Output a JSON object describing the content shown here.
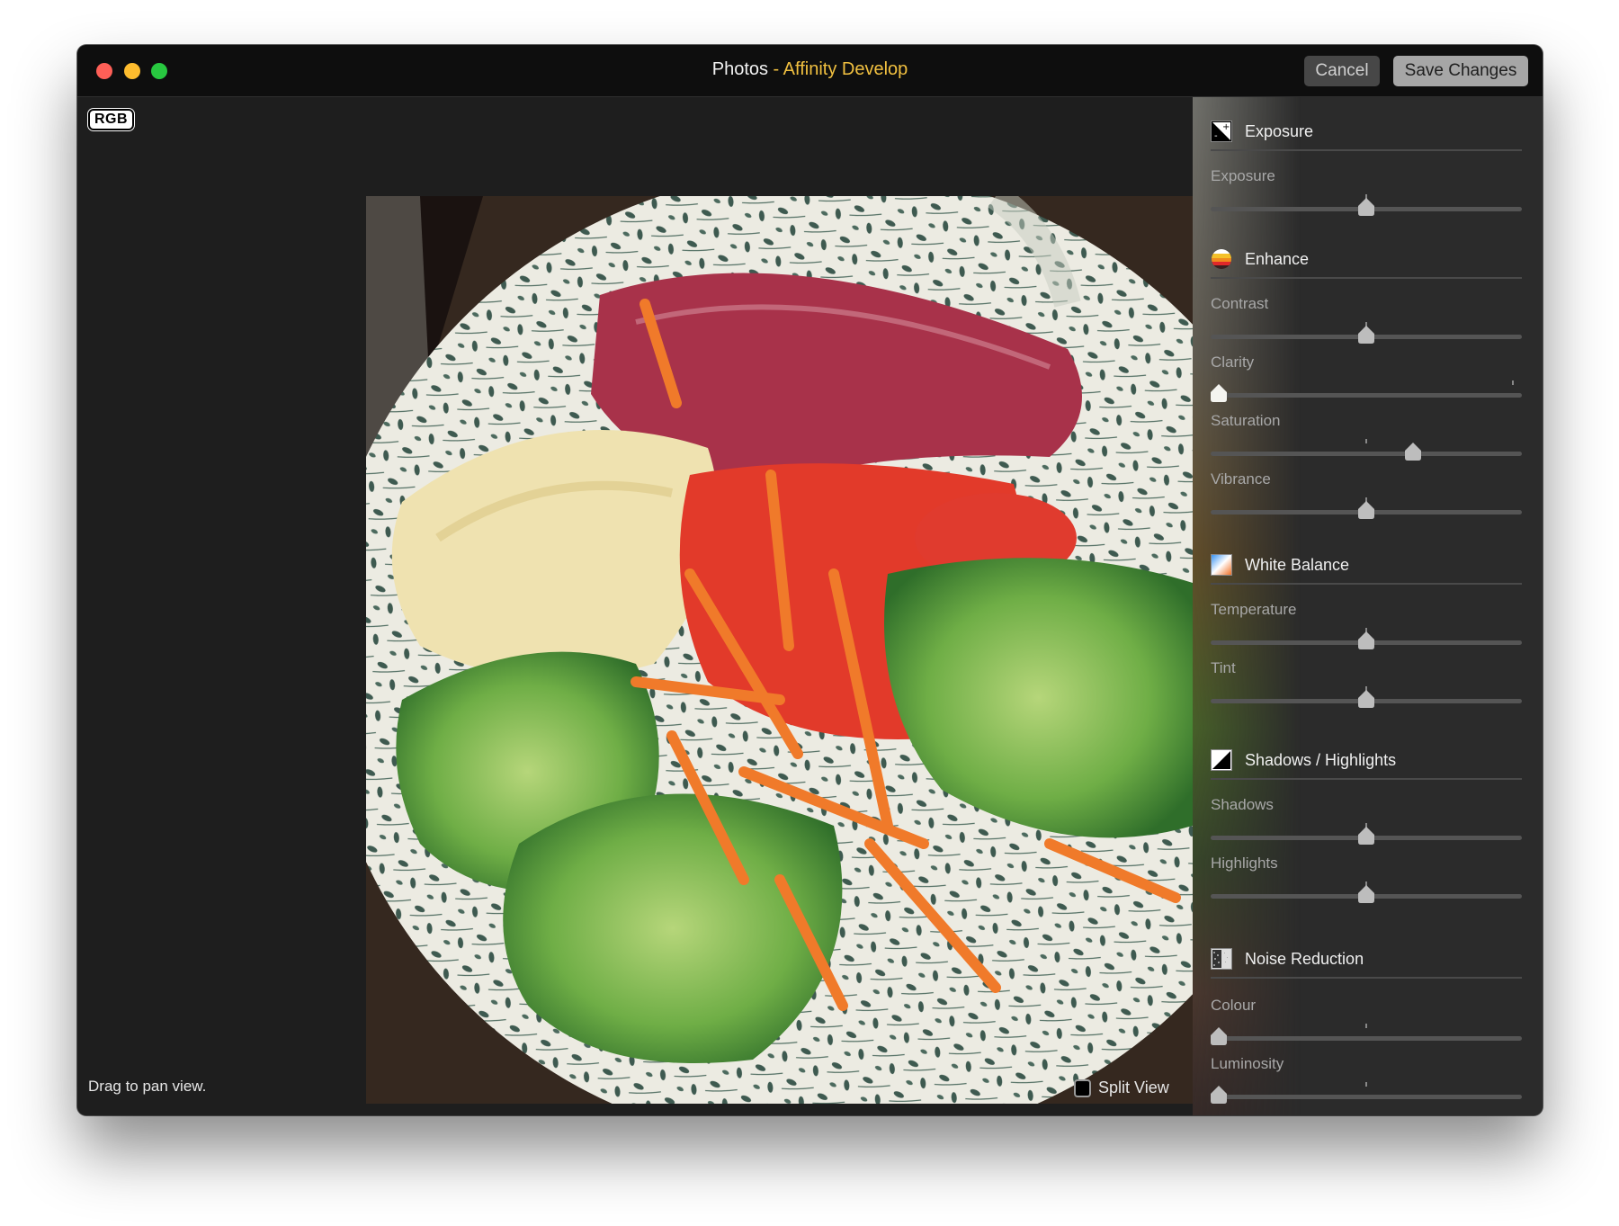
{
  "window": {
    "title_prefix": "Photos",
    "title_separator": " - ",
    "title_app": "Affinity Develop",
    "cancel_label": "Cancel",
    "save_label": "Save Changes"
  },
  "canvas": {
    "color_mode_badge": "RGB",
    "hint": "Drag to pan view.",
    "split_view_label": "Split View",
    "split_view_checked": false
  },
  "sidebar": {
    "sections": [
      {
        "id": "exposure",
        "title": "Exposure",
        "icon": "exposure-icon",
        "sliders": [
          {
            "label": "Exposure",
            "value": 0.5,
            "default": 0.5
          }
        ]
      },
      {
        "id": "enhance",
        "title": "Enhance",
        "icon": "enhance-icon",
        "sliders": [
          {
            "label": "Contrast",
            "value": 0.5,
            "default": 0.5
          },
          {
            "label": "Clarity",
            "value": 0.0,
            "default": 0.97,
            "active": true
          },
          {
            "label": "Saturation",
            "value": 0.66,
            "default": 0.5
          },
          {
            "label": "Vibrance",
            "value": 0.5,
            "default": 0.5
          }
        ]
      },
      {
        "id": "white-balance",
        "title": "White Balance",
        "icon": "white-balance-icon",
        "sliders": [
          {
            "label": "Temperature",
            "value": 0.5,
            "default": 0.5
          },
          {
            "label": "Tint",
            "value": 0.5,
            "default": 0.5
          }
        ]
      },
      {
        "id": "shadows-highlights",
        "title": "Shadows / Highlights",
        "icon": "shadows-highlights-icon",
        "sliders": [
          {
            "label": "Shadows",
            "value": 0.5,
            "default": 0.5
          },
          {
            "label": "Highlights",
            "value": 0.5,
            "default": 0.5
          }
        ]
      },
      {
        "id": "noise-reduction",
        "title": "Noise Reduction",
        "icon": "noise-reduction-icon",
        "sliders": [
          {
            "label": "Colour",
            "value": 0.0,
            "default": 0.5
          },
          {
            "label": "Luminosity",
            "value": 0.0,
            "default": 0.5
          }
        ]
      }
    ]
  },
  "colors": {
    "title_accent": "#f1c040",
    "close": "#fe5f57",
    "minimize": "#febc2e",
    "maximize": "#28c840"
  }
}
